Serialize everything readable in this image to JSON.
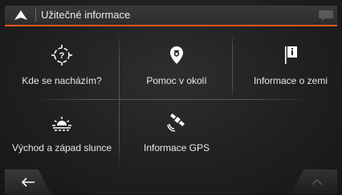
{
  "header": {
    "title": "Užitečné informace",
    "accent_color": "#e85a1b"
  },
  "tiles": [
    {
      "label": "Kde se nacházím?",
      "icon": "location-target-icon"
    },
    {
      "label": "Pomoc v okolí",
      "icon": "help-pin-icon"
    },
    {
      "label": "Informace o zemi",
      "icon": "country-info-flag-icon"
    },
    {
      "label": "Východ a západ slunce",
      "icon": "sunrise-icon"
    },
    {
      "label": "Informace GPS",
      "icon": "gps-satellite-icon"
    }
  ],
  "bottom": {
    "back_icon": "back-arrow-icon",
    "up_icon": "chevron-up-icon"
  }
}
